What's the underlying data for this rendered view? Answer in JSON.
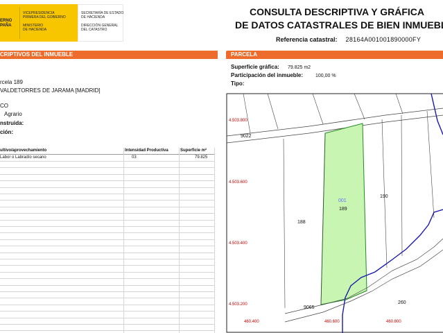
{
  "header": {
    "logo": {
      "gov": [
        "ERNO",
        "PAÑA"
      ],
      "col1": [
        "VICEPRESIDENCIA",
        "PRIMERA DEL GOBIERNO",
        "",
        "MINISTERIO",
        "DE HACIENDA"
      ],
      "col2": [
        "SECRETARÍA DE ESTADO",
        "DE HACIENDA",
        "",
        "DIRECCIÓN GENERAL",
        "DEL CATASTRO"
      ]
    },
    "title_line1": "CONSULTA DESCRIPTIVA Y GRÁFICA",
    "title_line2": "DE DATOS CATASTRALES DE BIEN INMUEBLE",
    "ref_label": "Referencia catastral:",
    "ref_value": "28164A001001890000FY"
  },
  "left": {
    "bar_prefix": "CRIPTIVOS DEL ",
    "bar_bold": "INMUEBLE",
    "rows": [
      {
        "text": "rcela 189",
        "bold": false
      },
      {
        "text": "VALDETORRES DE JARAMA [MADRID]",
        "bold": false
      },
      {
        "text": "CO",
        "bold": false
      },
      {
        "text": "Agrario",
        "bold": false
      },
      {
        "text": "nstruida:",
        "bold": true
      },
      {
        "text": "ción:",
        "bold": true
      }
    ],
    "table": {
      "headers": [
        "ultivo/aprovechamiento",
        "Intensidad Productiva",
        "Superficie m²"
      ],
      "rows": [
        [
          "Labor o Labradío secano",
          "03",
          "79.825"
        ]
      ]
    }
  },
  "right": {
    "bar": "PARCELA",
    "surface_label": "Superficie gráfica:",
    "surface_value": "79.825 m2",
    "participation_label": "Participación del inmueble:",
    "participation_value": "100,00 %",
    "tipo_label": "Tipo:"
  },
  "map": {
    "parcel_code": "001",
    "labels": [
      "9022",
      "188",
      "189",
      "190",
      "9065",
      "260"
    ],
    "y_coords": [
      "4.503.800",
      "4.503.600",
      "4.503.400",
      "4.503.200"
    ],
    "x_coords": [
      "460.400",
      "460.600",
      "460.800"
    ],
    "parcel_fill": "#c9f5b3",
    "parcel_stroke": "#1f8a1f",
    "river_color": "#1a1aa8",
    "coord_color": "#c40000"
  }
}
